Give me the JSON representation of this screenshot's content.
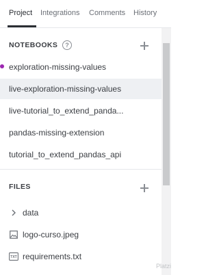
{
  "tabs": [
    {
      "label": "Project",
      "active": true
    },
    {
      "label": "Integrations",
      "active": false
    },
    {
      "label": "Comments",
      "active": false
    },
    {
      "label": "History",
      "active": false
    }
  ],
  "notebooks": {
    "header": "NOTEBOOKS",
    "help_icon": "?",
    "items": [
      {
        "label": "exploration-missing-values",
        "running": true
      },
      {
        "label": "live-exploration-missing-values",
        "selected": true
      },
      {
        "label": "live-tutorial_to_extend_panda..."
      },
      {
        "label": "pandas-missing-extension"
      },
      {
        "label": "tutorial_to_extend_pandas_api"
      }
    ]
  },
  "files": {
    "header": "FILES",
    "items": [
      {
        "label": "data",
        "icon": "chevron-right-icon"
      },
      {
        "label": "logo-curso.jpeg",
        "icon": "image-file-icon"
      },
      {
        "label": "requirements.txt",
        "icon": "txt-file-icon"
      }
    ]
  },
  "watermark": "Platzi",
  "colors": {
    "running_dot": "#9c27b0",
    "selected_bg": "#eef0f3"
  }
}
